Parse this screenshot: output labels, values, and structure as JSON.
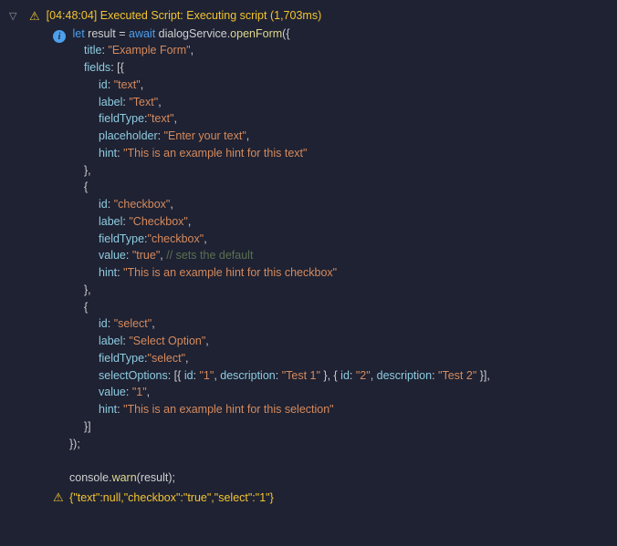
{
  "header": {
    "timestamp": "[04:48:04]",
    "title": "Executed Script:",
    "status": "Executing script",
    "duration": "(1,703ms)"
  },
  "code": {
    "l1a": "let",
    "l1b": " result ",
    "l1c": "=",
    "l1d": " await",
    "l1e": " dialogService.",
    "l1f": "openForm",
    "l1g": "({",
    "l2a": "title",
    "l2b": ": ",
    "l2c": "\"Example Form\"",
    "l2d": ",",
    "l3a": "fields",
    "l3b": ": [{",
    "l4a": "id",
    "l4b": ": ",
    "l4c": "\"text\"",
    "l4d": ",",
    "l5a": "label",
    "l5b": ": ",
    "l5c": "\"Text\"",
    "l5d": ",",
    "l6a": "fieldType",
    "l6b": ":",
    "l6c": "\"text\"",
    "l6d": ",",
    "l7a": "placeholder",
    "l7b": ": ",
    "l7c": "\"Enter your text\"",
    "l7d": ",",
    "l8a": "hint",
    "l8b": ": ",
    "l8c": "\"This is an example hint for this text\"",
    "l9": "},",
    "l10": "{",
    "l11a": "id",
    "l11b": ": ",
    "l11c": "\"checkbox\"",
    "l11d": ",",
    "l12a": "label",
    "l12b": ": ",
    "l12c": "\"Checkbox\"",
    "l12d": ",",
    "l13a": "fieldType",
    "l13b": ":",
    "l13c": "\"checkbox\"",
    "l13d": ",",
    "l14a": "value",
    "l14b": ": ",
    "l14c": "\"true\"",
    "l14d": ", ",
    "l14e": "// sets the default",
    "l15a": "hint",
    "l15b": ": ",
    "l15c": "\"This is an example hint for this checkbox\"",
    "l16": "},",
    "l17": "{",
    "l18a": "id",
    "l18b": ": ",
    "l18c": "\"select\"",
    "l18d": ",",
    "l19a": "label",
    "l19b": ": ",
    "l19c": "\"Select Option\"",
    "l19d": ",",
    "l20a": "fieldType",
    "l20b": ":",
    "l20c": "\"select\"",
    "l20d": ",",
    "l21a": "selectOptions",
    "l21b": ": [{ ",
    "l21c": "id",
    "l21d": ": ",
    "l21e": "\"1\"",
    "l21f": ", ",
    "l21g": "description",
    "l21h": ": ",
    "l21i": "\"Test 1\"",
    "l21j": " }, { ",
    "l21k": "id",
    "l21l": ": ",
    "l21m": "\"2\"",
    "l21n": ", ",
    "l21o": "description",
    "l21p": ": ",
    "l21q": "\"Test 2\"",
    "l21r": " }],",
    "l22a": "value",
    "l22b": ": ",
    "l22c": "\"1\"",
    "l22d": ",",
    "l23a": "hint",
    "l23b": ": ",
    "l23c": "\"This is an example hint for this selection\"",
    "l24": "}]",
    "l25": "});",
    "l26a": "console.",
    "l26b": "warn",
    "l26c": "(result);"
  },
  "result": {
    "text": "{\"text\":null,\"checkbox\":\"true\",\"select\":\"1\"}"
  }
}
